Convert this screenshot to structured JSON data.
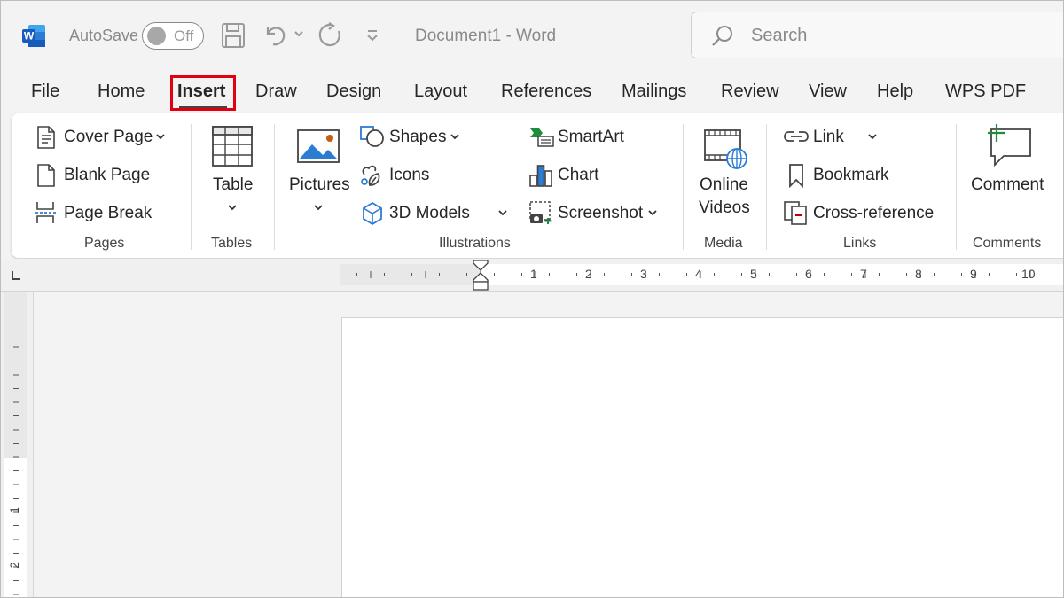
{
  "titlebar": {
    "autosave_label": "AutoSave",
    "autosave_state": "Off",
    "document_title": "Document1  -  Word",
    "search_placeholder": "Search"
  },
  "tabs": [
    {
      "label": "File"
    },
    {
      "label": "Home"
    },
    {
      "label": "Insert",
      "active": true
    },
    {
      "label": "Draw"
    },
    {
      "label": "Design"
    },
    {
      "label": "Layout"
    },
    {
      "label": "References"
    },
    {
      "label": "Mailings"
    },
    {
      "label": "Review"
    },
    {
      "label": "View"
    },
    {
      "label": "Help"
    },
    {
      "label": "WPS PDF"
    }
  ],
  "ribbon": {
    "pages": {
      "label": "Pages",
      "cover_page": "Cover Page",
      "blank_page": "Blank Page",
      "page_break": "Page Break"
    },
    "tables": {
      "label": "Tables",
      "table": "Table"
    },
    "illustrations": {
      "label": "Illustrations",
      "pictures": "Pictures",
      "shapes": "Shapes",
      "icons": "Icons",
      "models_3d": "3D Models",
      "smartart": "SmartArt",
      "chart": "Chart",
      "screenshot": "Screenshot"
    },
    "media": {
      "label": "Media",
      "online_videos_1": "Online",
      "online_videos_2": "Videos"
    },
    "links": {
      "label": "Links",
      "link": "Link",
      "bookmark": "Bookmark",
      "cross_reference": "Cross-reference"
    },
    "comments": {
      "label": "Comments",
      "comment": "Comment"
    }
  },
  "ruler": {
    "numbers": [
      "1",
      "2",
      "3",
      "4",
      "5",
      "6",
      "7",
      "8",
      "9",
      "10"
    ],
    "vertical_numbers": [
      "1",
      "2"
    ]
  },
  "colors": {
    "word_blue": "#185abd",
    "highlight_red": "#e00012",
    "accent_green": "#1e8c3a",
    "accent_blue": "#2b7cd3"
  }
}
